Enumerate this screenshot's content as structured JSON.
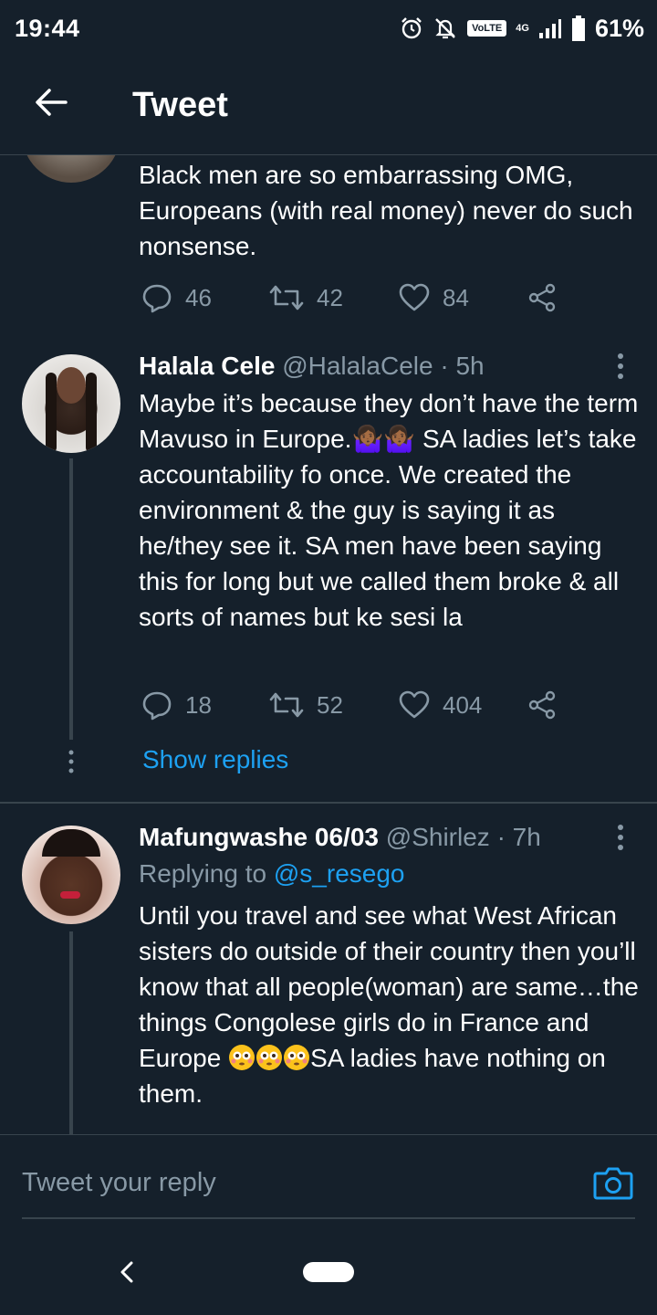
{
  "status_bar": {
    "time": "19:44",
    "volte": "VoLTE",
    "network": "4G",
    "battery": "61%",
    "icons": [
      "alarm-icon",
      "mute-icon",
      "signal-icon",
      "battery-icon"
    ]
  },
  "header": {
    "title": "Tweet",
    "back_icon": "arrow-left-icon"
  },
  "tweets": [
    {
      "text": "Black men are so embarrassing OMG, Europeans (with real money) never do such nonsense.",
      "replies": "46",
      "retweets": "42",
      "likes": "84"
    },
    {
      "name": "Halala Cele",
      "handle": "@HalalaCele",
      "separator": "·",
      "time": "5h",
      "text_1": "Maybe it’s because they don’t have the term Mavuso in Europe.",
      "emoji": "🤷🏾‍♀️🤷🏾‍♀️",
      "text_2": " SA ladies let’s take accountability fo once. We created the environment & the guy is saying it as he/they see it. SA men have been saying this for long but we called them broke & all sorts of names but ke sesi la",
      "replies": "18",
      "retweets": "52",
      "likes": "404",
      "show_replies": "Show replies"
    },
    {
      "name": "Mafungwashe 06/03",
      "handle": "@Shirlez",
      "separator": "·",
      "time": "7h",
      "replying_prefix": "Replying to ",
      "replying_to": "@s_resego",
      "text": "Until you travel and see what West African sisters do outside of their country then you’ll know that all people(woman) are same…the things Congolese girls do in France and Europe",
      "text_end": "SA ladies have nothing on them."
    }
  ],
  "reply_bar": {
    "placeholder": "Tweet your reply",
    "camera_icon": "camera-icon"
  },
  "colors": {
    "background": "#15202b",
    "accent": "#1da1f2",
    "secondary_text": "#8899a6",
    "divider": "#38444d"
  }
}
